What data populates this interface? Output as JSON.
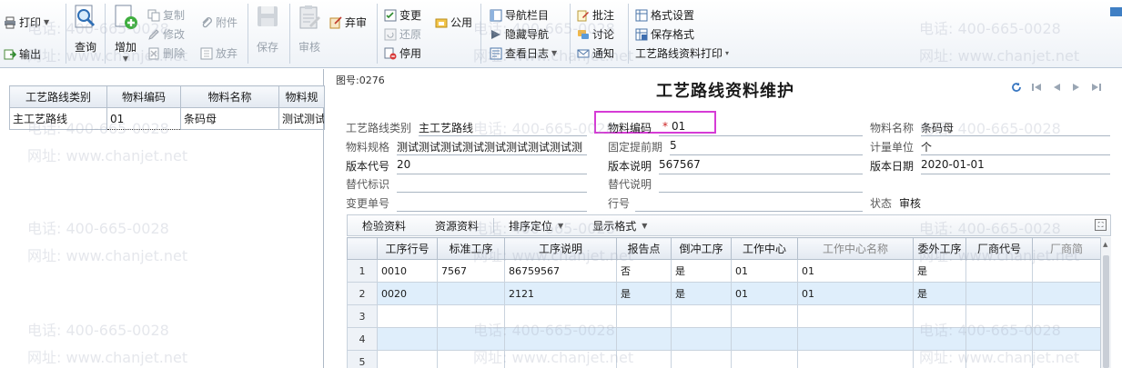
{
  "toolbar": {
    "print": "打印",
    "output": "输出",
    "query": "查询",
    "add": "增加",
    "copy": "复制",
    "modify": "修改",
    "delete": "删除",
    "attach": "附件",
    "abandon_gray": "放弃",
    "save": "保存",
    "audit": "审核",
    "abandon_audit": "弃审",
    "change": "变更",
    "restore": "还原",
    "disable": "停用",
    "public": "公用",
    "nav_bar": "导航栏目",
    "hide_nav": "隐藏导航",
    "view_log": "查看日志",
    "annotate": "批注",
    "discuss": "讨论",
    "notify": "通知",
    "format_settings": "格式设置",
    "save_format": "保存格式",
    "route_print": "工艺路线资料打印"
  },
  "left_table": {
    "headers": [
      "工艺路线类别",
      "物料编码",
      "物料名称",
      "物料规"
    ],
    "rows": [
      [
        "主工艺路线",
        "01",
        "条码母",
        "测试测试"
      ]
    ]
  },
  "form": {
    "doc_no": "图号:0276",
    "title": "工艺路线资料维护",
    "route_type_label": "工艺路线类别",
    "route_type_value": "主工艺路线",
    "material_code_label": "物料编码",
    "material_code_required": "*",
    "material_code_value": "01",
    "material_name_label": "物料名称",
    "material_name_value": "条码母",
    "spec_label": "物料规格",
    "spec_value": "测试测试测试测试测试测试测试测试测",
    "lead_label": "固定提前期",
    "lead_value": "5",
    "unit_label": "计量单位",
    "unit_value": "个",
    "version_code_label": "版本代号",
    "version_code_value": "20",
    "version_desc_label": "版本说明",
    "version_desc_value": "567567",
    "version_date_label": "版本日期",
    "version_date_value": "2020-01-01",
    "sub_flag_label": "替代标识",
    "sub_desc_label": "替代说明",
    "change_no_label": "变更单号",
    "row_no_label": "行号",
    "status_label": "状态",
    "status_value": "审核"
  },
  "grid_toolbar": {
    "inspect": "检验资料",
    "resource": "资源资料",
    "sort": "排序定位",
    "display": "显示格式"
  },
  "grid": {
    "headers": [
      "工序行号",
      "标准工序",
      "工序说明",
      "报告点",
      "倒冲工序",
      "工作中心",
      "工作中心名称",
      "委外工序",
      "厂商代号",
      "厂商简"
    ],
    "rows": [
      {
        "no": "1",
        "cells": [
          "0010",
          "7567",
          "86759567",
          "否",
          "是",
          "01",
          "01",
          "是",
          "",
          ""
        ]
      },
      {
        "no": "2",
        "cells": [
          "0020",
          "",
          "2121",
          "是",
          "是",
          "01",
          "01",
          "是",
          "",
          ""
        ]
      },
      {
        "no": "3",
        "cells": [
          "",
          "",
          "",
          "",
          "",
          "",
          "",
          "",
          "",
          ""
        ]
      },
      {
        "no": "4",
        "cells": [
          "",
          "",
          "",
          "",
          "",
          "",
          "",
          "",
          "",
          ""
        ]
      },
      {
        "no": "5",
        "cells": [
          "",
          "",
          "",
          "",
          "",
          "",
          "",
          "",
          "",
          ""
        ]
      }
    ]
  },
  "watermarks": {
    "phone": "电话: 400-665-0028",
    "site": "网址: www.chanjet.net"
  }
}
